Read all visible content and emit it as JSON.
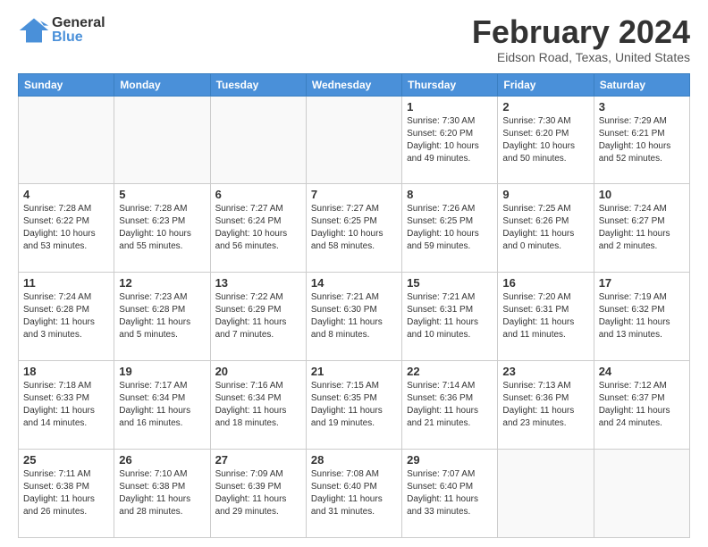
{
  "header": {
    "logo": {
      "line1": "General",
      "line2": "Blue"
    },
    "title": "February 2024",
    "subtitle": "Eidson Road, Texas, United States"
  },
  "calendar": {
    "weekdays": [
      "Sunday",
      "Monday",
      "Tuesday",
      "Wednesday",
      "Thursday",
      "Friday",
      "Saturday"
    ],
    "weeks": [
      [
        {
          "day": "",
          "info": ""
        },
        {
          "day": "",
          "info": ""
        },
        {
          "day": "",
          "info": ""
        },
        {
          "day": "",
          "info": ""
        },
        {
          "day": "1",
          "info": "Sunrise: 7:30 AM\nSunset: 6:20 PM\nDaylight: 10 hours\nand 49 minutes."
        },
        {
          "day": "2",
          "info": "Sunrise: 7:30 AM\nSunset: 6:20 PM\nDaylight: 10 hours\nand 50 minutes."
        },
        {
          "day": "3",
          "info": "Sunrise: 7:29 AM\nSunset: 6:21 PM\nDaylight: 10 hours\nand 52 minutes."
        }
      ],
      [
        {
          "day": "4",
          "info": "Sunrise: 7:28 AM\nSunset: 6:22 PM\nDaylight: 10 hours\nand 53 minutes."
        },
        {
          "day": "5",
          "info": "Sunrise: 7:28 AM\nSunset: 6:23 PM\nDaylight: 10 hours\nand 55 minutes."
        },
        {
          "day": "6",
          "info": "Sunrise: 7:27 AM\nSunset: 6:24 PM\nDaylight: 10 hours\nand 56 minutes."
        },
        {
          "day": "7",
          "info": "Sunrise: 7:27 AM\nSunset: 6:25 PM\nDaylight: 10 hours\nand 58 minutes."
        },
        {
          "day": "8",
          "info": "Sunrise: 7:26 AM\nSunset: 6:25 PM\nDaylight: 10 hours\nand 59 minutes."
        },
        {
          "day": "9",
          "info": "Sunrise: 7:25 AM\nSunset: 6:26 PM\nDaylight: 11 hours\nand 0 minutes."
        },
        {
          "day": "10",
          "info": "Sunrise: 7:24 AM\nSunset: 6:27 PM\nDaylight: 11 hours\nand 2 minutes."
        }
      ],
      [
        {
          "day": "11",
          "info": "Sunrise: 7:24 AM\nSunset: 6:28 PM\nDaylight: 11 hours\nand 3 minutes."
        },
        {
          "day": "12",
          "info": "Sunrise: 7:23 AM\nSunset: 6:28 PM\nDaylight: 11 hours\nand 5 minutes."
        },
        {
          "day": "13",
          "info": "Sunrise: 7:22 AM\nSunset: 6:29 PM\nDaylight: 11 hours\nand 7 minutes."
        },
        {
          "day": "14",
          "info": "Sunrise: 7:21 AM\nSunset: 6:30 PM\nDaylight: 11 hours\nand 8 minutes."
        },
        {
          "day": "15",
          "info": "Sunrise: 7:21 AM\nSunset: 6:31 PM\nDaylight: 11 hours\nand 10 minutes."
        },
        {
          "day": "16",
          "info": "Sunrise: 7:20 AM\nSunset: 6:31 PM\nDaylight: 11 hours\nand 11 minutes."
        },
        {
          "day": "17",
          "info": "Sunrise: 7:19 AM\nSunset: 6:32 PM\nDaylight: 11 hours\nand 13 minutes."
        }
      ],
      [
        {
          "day": "18",
          "info": "Sunrise: 7:18 AM\nSunset: 6:33 PM\nDaylight: 11 hours\nand 14 minutes."
        },
        {
          "day": "19",
          "info": "Sunrise: 7:17 AM\nSunset: 6:34 PM\nDaylight: 11 hours\nand 16 minutes."
        },
        {
          "day": "20",
          "info": "Sunrise: 7:16 AM\nSunset: 6:34 PM\nDaylight: 11 hours\nand 18 minutes."
        },
        {
          "day": "21",
          "info": "Sunrise: 7:15 AM\nSunset: 6:35 PM\nDaylight: 11 hours\nand 19 minutes."
        },
        {
          "day": "22",
          "info": "Sunrise: 7:14 AM\nSunset: 6:36 PM\nDaylight: 11 hours\nand 21 minutes."
        },
        {
          "day": "23",
          "info": "Sunrise: 7:13 AM\nSunset: 6:36 PM\nDaylight: 11 hours\nand 23 minutes."
        },
        {
          "day": "24",
          "info": "Sunrise: 7:12 AM\nSunset: 6:37 PM\nDaylight: 11 hours\nand 24 minutes."
        }
      ],
      [
        {
          "day": "25",
          "info": "Sunrise: 7:11 AM\nSunset: 6:38 PM\nDaylight: 11 hours\nand 26 minutes."
        },
        {
          "day": "26",
          "info": "Sunrise: 7:10 AM\nSunset: 6:38 PM\nDaylight: 11 hours\nand 28 minutes."
        },
        {
          "day": "27",
          "info": "Sunrise: 7:09 AM\nSunset: 6:39 PM\nDaylight: 11 hours\nand 29 minutes."
        },
        {
          "day": "28",
          "info": "Sunrise: 7:08 AM\nSunset: 6:40 PM\nDaylight: 11 hours\nand 31 minutes."
        },
        {
          "day": "29",
          "info": "Sunrise: 7:07 AM\nSunset: 6:40 PM\nDaylight: 11 hours\nand 33 minutes."
        },
        {
          "day": "",
          "info": ""
        },
        {
          "day": "",
          "info": ""
        }
      ]
    ]
  }
}
